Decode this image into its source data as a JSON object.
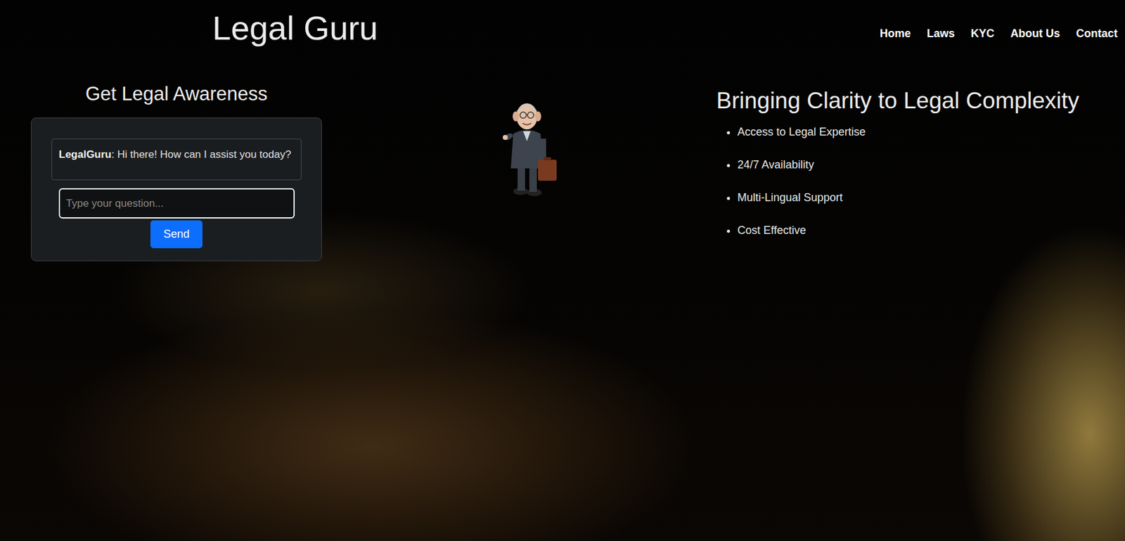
{
  "header": {
    "logo": "Legal Guru",
    "nav": [
      "Home",
      "Laws",
      "KYC",
      "About Us",
      "Contact"
    ]
  },
  "chat": {
    "title": "Get Legal Awareness",
    "messages": [
      {
        "sender": "LegalGuru",
        "text": ": Hi there! How can I assist you today?"
      }
    ],
    "input": {
      "placeholder": "Type your question...",
      "focused": true
    },
    "send": "Send"
  },
  "hero": {
    "title": "Bringing Clarity to Legal Complexity",
    "features": [
      "Access to Legal Expertise",
      "24/7 Availability",
      "Multi-Lingual Support",
      "Cost Effective"
    ]
  }
}
